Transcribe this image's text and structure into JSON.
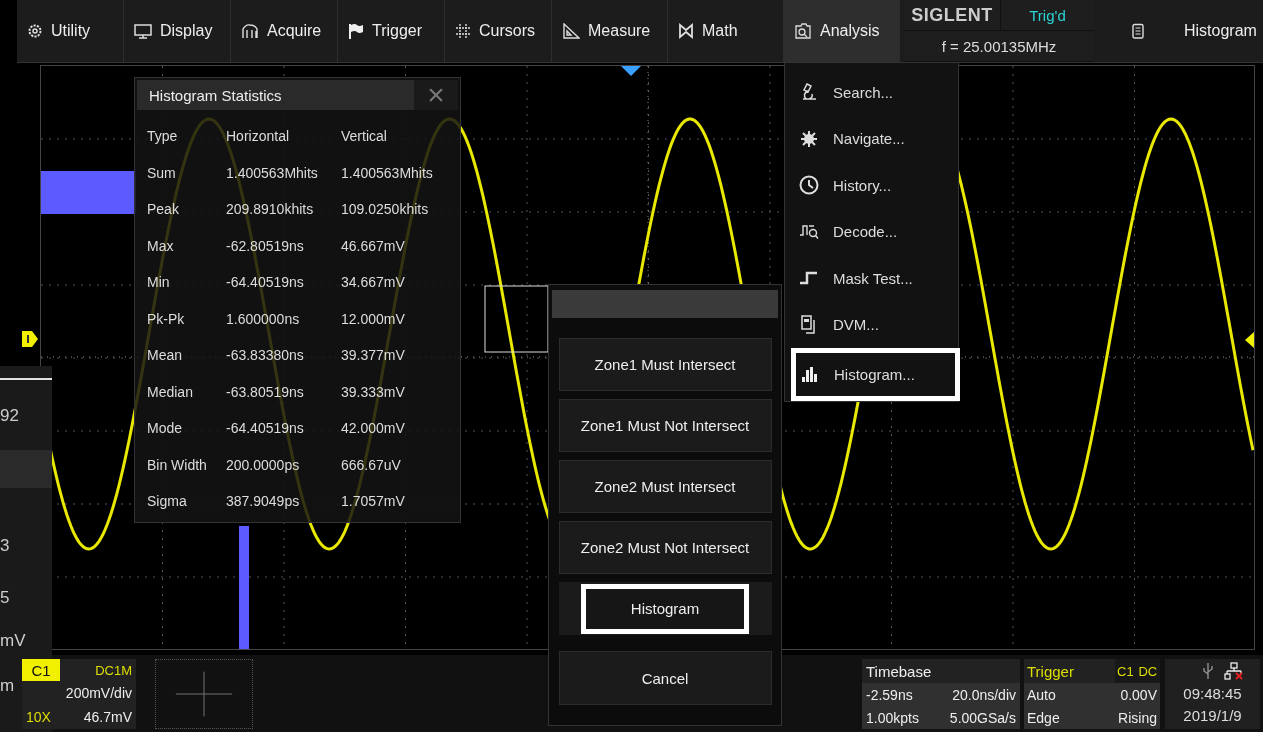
{
  "top_menu": [
    {
      "label": "Utility",
      "selected": false
    },
    {
      "label": "Display",
      "selected": false
    },
    {
      "label": "Acquire",
      "selected": false
    },
    {
      "label": "Trigger",
      "selected": false
    },
    {
      "label": "Cursors",
      "selected": false
    },
    {
      "label": "Measure",
      "selected": false
    },
    {
      "label": "Math",
      "selected": false
    },
    {
      "label": "Analysis",
      "selected": true
    }
  ],
  "brand": {
    "logo": "SIGLENT",
    "trigger_status": "Trig'd",
    "frequency": "f = 25.00135MHz"
  },
  "current_mode": "Histogram",
  "side_fragment": [
    "92",
    "3",
    "5",
    "mV",
    "m"
  ],
  "histogram_statistics": {
    "title": "Histogram Statistics",
    "close": "×",
    "columns": [
      "Type",
      "Horizontal",
      "Vertical"
    ],
    "rows": [
      [
        "Sum",
        "1.400563Mhits",
        "1.400563Mhits"
      ],
      [
        "Peak",
        "209.8910khits",
        "109.0250khits"
      ],
      [
        "Max",
        "-62.80519ns",
        "46.667mV"
      ],
      [
        "Min",
        "-64.40519ns",
        "34.667mV"
      ],
      [
        "Pk-Pk",
        "1.600000ns",
        "12.000mV"
      ],
      [
        "Mean",
        "-63.83380ns",
        "39.377mV"
      ],
      [
        "Median",
        "-63.80519ns",
        "39.333mV"
      ],
      [
        "Mode",
        "-64.40519ns",
        "42.000mV"
      ],
      [
        "Bin Width",
        "200.0000ps",
        "666.67uV"
      ],
      [
        "Sigma",
        "387.9049ps",
        "1.7057mV"
      ]
    ]
  },
  "analysis_menu": [
    {
      "label": "Search...",
      "selected": false
    },
    {
      "label": "Navigate...",
      "selected": false
    },
    {
      "label": "History...",
      "selected": false
    },
    {
      "label": "Decode...",
      "selected": false
    },
    {
      "label": "Mask Test...",
      "selected": false
    },
    {
      "label": "DVM...",
      "selected": false
    },
    {
      "label": "Histogram...",
      "selected": true
    }
  ],
  "zone_menu": {
    "options": [
      {
        "label": "Zone1 Must Intersect",
        "selected": false
      },
      {
        "label": "Zone1 Must Not Intersect",
        "selected": false
      },
      {
        "label": "Zone2 Must Intersect",
        "selected": false
      },
      {
        "label": "Zone2 Must Not Intersect",
        "selected": false
      },
      {
        "label": "Histogram",
        "selected": true
      }
    ],
    "cancel": "Cancel"
  },
  "channel": {
    "name": "C1",
    "coupling": "DC1M",
    "scale": "200mV/div",
    "probe": "10X",
    "offset": "46.7mV"
  },
  "timebase": {
    "title": "Timebase",
    "delay": "-2.59ns",
    "scale": "20.0ns/div",
    "points": "1.00kpts",
    "rate": "5.00GSa/s"
  },
  "trigger": {
    "title": "Trigger",
    "source": "C1",
    "coupling": "DC",
    "mode": "Auto",
    "level": "0.00V",
    "type": "Edge",
    "slope": "Rising"
  },
  "clock": {
    "time": "09:48:45",
    "date": "2019/1/9"
  }
}
